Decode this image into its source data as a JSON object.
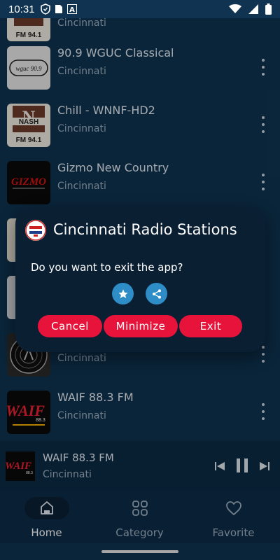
{
  "status_bar": {
    "time": "10:31",
    "left_icons": [
      "shield-icon",
      "sim-card-icon",
      "a-icon"
    ],
    "right_icons": [
      "wifi-icon",
      "signal-icon",
      "battery-icon"
    ]
  },
  "stations": [
    {
      "name": "",
      "city": "Cincinnati",
      "logo": "nash-fm-logo",
      "logo_text": "FM 94.1"
    },
    {
      "name": "90.9 WGUC Classical",
      "city": "Cincinnati",
      "logo": "wguc-logo",
      "logo_text": "WGUC 90.9"
    },
    {
      "name": "Chill - WNNF-HD2",
      "city": "Cincinnati",
      "logo": "nash-fm-logo",
      "logo_text": "NASH",
      "logo_sub": "FM 94.1"
    },
    {
      "name": "Gizmo New Country",
      "city": "Cincinnati",
      "logo": "gizmo-logo",
      "logo_text": "GIZMO"
    },
    {
      "name": "",
      "city": "",
      "logo": "partial-logo"
    },
    {
      "name": "",
      "city": "",
      "logo": "partial-logo"
    },
    {
      "name": "",
      "city": "Cincinnati",
      "logo": "vinyl-logo"
    },
    {
      "name": "WAIF 88.3 FM",
      "city": "Cincinnati",
      "logo": "waif-logo",
      "logo_text": "WAIF",
      "logo_sub": "88.3"
    }
  ],
  "dialog": {
    "title": "Cincinnati Radio Stations",
    "message": "Do you want to exit the app?",
    "icons": [
      "star-icon",
      "share-icon"
    ],
    "buttons": {
      "cancel": "Cancel",
      "minimize": "Minimize",
      "exit": "Exit"
    }
  },
  "player": {
    "name": "WAIF 88.3 FM",
    "city": "Cincinnati",
    "logo_text": "WAIF",
    "logo_sub": "88.3",
    "controls": [
      "skip-previous-icon",
      "pause-icon",
      "skip-next-icon"
    ]
  },
  "nav": {
    "items": [
      {
        "label": "Home",
        "icon": "home-icon",
        "active": true
      },
      {
        "label": "Category",
        "icon": "category-icon",
        "active": false
      },
      {
        "label": "Favorite",
        "icon": "heart-icon",
        "active": false
      }
    ]
  },
  "colors": {
    "background": "#0f3350",
    "dialog": "#0b1f33",
    "accent_red": "#e8133a",
    "accent_blue": "#2e8cc7"
  }
}
